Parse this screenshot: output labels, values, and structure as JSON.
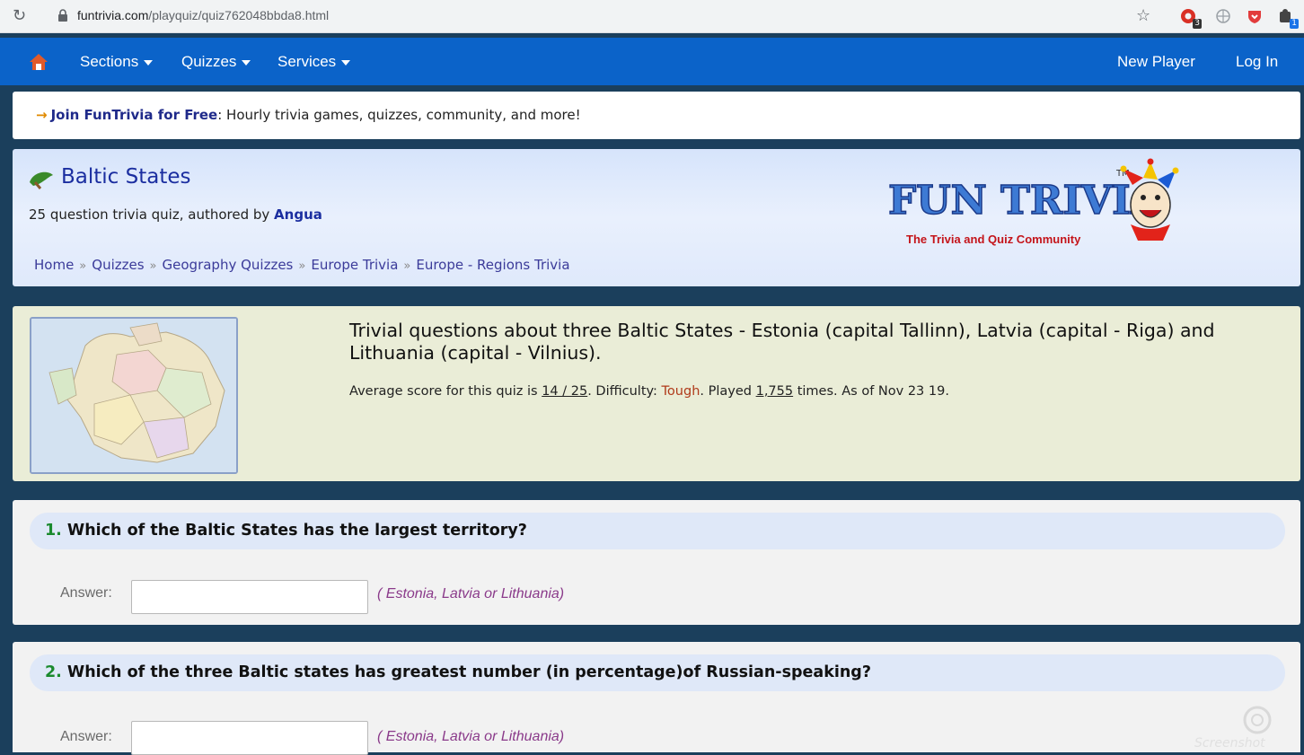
{
  "browser": {
    "url_host": "funtrivia.com",
    "url_path": "/playquiz/quiz762048bbda8.html",
    "extension_badges": [
      "3",
      "1"
    ]
  },
  "nav": {
    "items": [
      {
        "label": "Sections"
      },
      {
        "label": "Quizzes"
      },
      {
        "label": "Services"
      }
    ],
    "new_player": "New Player",
    "log_in": "Log In"
  },
  "join": {
    "link": "Join FunTrivia for Free",
    "text": ": Hourly trivia games, quizzes, community, and more!"
  },
  "quiz": {
    "title": "Baltic States",
    "sub_prefix": "25 question trivia quiz, authored by ",
    "author": "Angua",
    "breadcrumbs": [
      "Home",
      "Quizzes",
      "Geography Quizzes",
      "Europe Trivia",
      "Europe - Regions Trivia"
    ],
    "breadcrumb_sep": "»",
    "description": "Trivial questions about three Baltic States - Estonia (capital Tallinn), Latvia (capital - Riga) and Lithuania (capital - Vilnius).",
    "stats": {
      "prefix": "Average score for this quiz is ",
      "avg_score": "14 / 25",
      "difficulty_label": ". Difficulty: ",
      "difficulty": "Tough",
      "played_label": ". Played ",
      "played": "1,755",
      "suffix": " times. As of Nov 23 19."
    }
  },
  "logo": {
    "wordmark": "FUN TRIVIA",
    "tm": "TM",
    "tagline": "The Trivia and Quiz Community"
  },
  "questions": [
    {
      "number": "1.",
      "text": "Which of the Baltic States has the largest territory?",
      "answer_label": "Answer:",
      "answer_value": "",
      "hint": "( Estonia, Latvia or Lithuania)"
    },
    {
      "number": "2.",
      "text": "Which of the three Baltic states has greatest number (in percentage)of Russian-speaking?",
      "answer_label": "Answer:",
      "answer_value": "",
      "hint": "( Estonia, Latvia or Lithuania)"
    }
  ],
  "colors": {
    "nav_bg": "#0b63c9",
    "page_bg": "#1b3f5c",
    "title_blue": "#1b2ea0",
    "difficulty_red": "#b03a1a",
    "hint_purple": "#8a3a8a",
    "question_number_green": "#1b8a2e"
  },
  "watermark": "Screenshot"
}
